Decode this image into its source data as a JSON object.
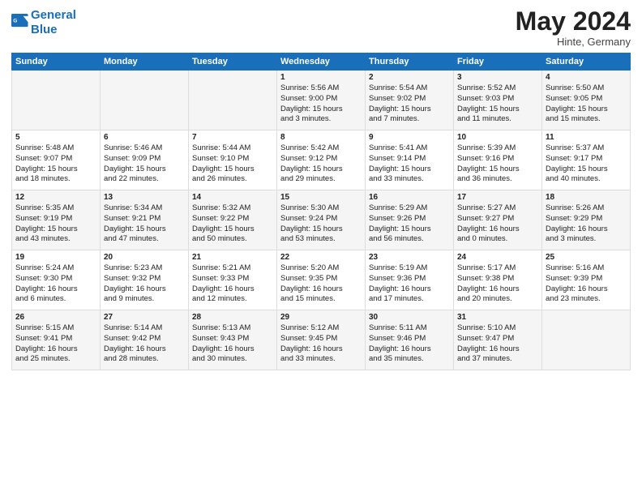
{
  "header": {
    "logo_line1": "General",
    "logo_line2": "Blue",
    "month": "May 2024",
    "location": "Hinte, Germany"
  },
  "weekdays": [
    "Sunday",
    "Monday",
    "Tuesday",
    "Wednesday",
    "Thursday",
    "Friday",
    "Saturday"
  ],
  "weeks": [
    [
      {
        "day": "",
        "info": ""
      },
      {
        "day": "",
        "info": ""
      },
      {
        "day": "",
        "info": ""
      },
      {
        "day": "1",
        "info": "Sunrise: 5:56 AM\nSunset: 9:00 PM\nDaylight: 15 hours\nand 3 minutes."
      },
      {
        "day": "2",
        "info": "Sunrise: 5:54 AM\nSunset: 9:02 PM\nDaylight: 15 hours\nand 7 minutes."
      },
      {
        "day": "3",
        "info": "Sunrise: 5:52 AM\nSunset: 9:03 PM\nDaylight: 15 hours\nand 11 minutes."
      },
      {
        "day": "4",
        "info": "Sunrise: 5:50 AM\nSunset: 9:05 PM\nDaylight: 15 hours\nand 15 minutes."
      }
    ],
    [
      {
        "day": "5",
        "info": "Sunrise: 5:48 AM\nSunset: 9:07 PM\nDaylight: 15 hours\nand 18 minutes."
      },
      {
        "day": "6",
        "info": "Sunrise: 5:46 AM\nSunset: 9:09 PM\nDaylight: 15 hours\nand 22 minutes."
      },
      {
        "day": "7",
        "info": "Sunrise: 5:44 AM\nSunset: 9:10 PM\nDaylight: 15 hours\nand 26 minutes."
      },
      {
        "day": "8",
        "info": "Sunrise: 5:42 AM\nSunset: 9:12 PM\nDaylight: 15 hours\nand 29 minutes."
      },
      {
        "day": "9",
        "info": "Sunrise: 5:41 AM\nSunset: 9:14 PM\nDaylight: 15 hours\nand 33 minutes."
      },
      {
        "day": "10",
        "info": "Sunrise: 5:39 AM\nSunset: 9:16 PM\nDaylight: 15 hours\nand 36 minutes."
      },
      {
        "day": "11",
        "info": "Sunrise: 5:37 AM\nSunset: 9:17 PM\nDaylight: 15 hours\nand 40 minutes."
      }
    ],
    [
      {
        "day": "12",
        "info": "Sunrise: 5:35 AM\nSunset: 9:19 PM\nDaylight: 15 hours\nand 43 minutes."
      },
      {
        "day": "13",
        "info": "Sunrise: 5:34 AM\nSunset: 9:21 PM\nDaylight: 15 hours\nand 47 minutes."
      },
      {
        "day": "14",
        "info": "Sunrise: 5:32 AM\nSunset: 9:22 PM\nDaylight: 15 hours\nand 50 minutes."
      },
      {
        "day": "15",
        "info": "Sunrise: 5:30 AM\nSunset: 9:24 PM\nDaylight: 15 hours\nand 53 minutes."
      },
      {
        "day": "16",
        "info": "Sunrise: 5:29 AM\nSunset: 9:26 PM\nDaylight: 15 hours\nand 56 minutes."
      },
      {
        "day": "17",
        "info": "Sunrise: 5:27 AM\nSunset: 9:27 PM\nDaylight: 16 hours\nand 0 minutes."
      },
      {
        "day": "18",
        "info": "Sunrise: 5:26 AM\nSunset: 9:29 PM\nDaylight: 16 hours\nand 3 minutes."
      }
    ],
    [
      {
        "day": "19",
        "info": "Sunrise: 5:24 AM\nSunset: 9:30 PM\nDaylight: 16 hours\nand 6 minutes."
      },
      {
        "day": "20",
        "info": "Sunrise: 5:23 AM\nSunset: 9:32 PM\nDaylight: 16 hours\nand 9 minutes."
      },
      {
        "day": "21",
        "info": "Sunrise: 5:21 AM\nSunset: 9:33 PM\nDaylight: 16 hours\nand 12 minutes."
      },
      {
        "day": "22",
        "info": "Sunrise: 5:20 AM\nSunset: 9:35 PM\nDaylight: 16 hours\nand 15 minutes."
      },
      {
        "day": "23",
        "info": "Sunrise: 5:19 AM\nSunset: 9:36 PM\nDaylight: 16 hours\nand 17 minutes."
      },
      {
        "day": "24",
        "info": "Sunrise: 5:17 AM\nSunset: 9:38 PM\nDaylight: 16 hours\nand 20 minutes."
      },
      {
        "day": "25",
        "info": "Sunrise: 5:16 AM\nSunset: 9:39 PM\nDaylight: 16 hours\nand 23 minutes."
      }
    ],
    [
      {
        "day": "26",
        "info": "Sunrise: 5:15 AM\nSunset: 9:41 PM\nDaylight: 16 hours\nand 25 minutes."
      },
      {
        "day": "27",
        "info": "Sunrise: 5:14 AM\nSunset: 9:42 PM\nDaylight: 16 hours\nand 28 minutes."
      },
      {
        "day": "28",
        "info": "Sunrise: 5:13 AM\nSunset: 9:43 PM\nDaylight: 16 hours\nand 30 minutes."
      },
      {
        "day": "29",
        "info": "Sunrise: 5:12 AM\nSunset: 9:45 PM\nDaylight: 16 hours\nand 33 minutes."
      },
      {
        "day": "30",
        "info": "Sunrise: 5:11 AM\nSunset: 9:46 PM\nDaylight: 16 hours\nand 35 minutes."
      },
      {
        "day": "31",
        "info": "Sunrise: 5:10 AM\nSunset: 9:47 PM\nDaylight: 16 hours\nand 37 minutes."
      },
      {
        "day": "",
        "info": ""
      }
    ]
  ]
}
